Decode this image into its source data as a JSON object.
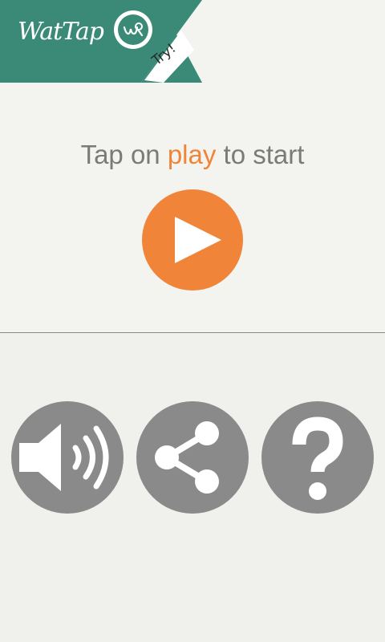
{
  "header": {
    "logo_text": "WatTap",
    "try_label": "Try!",
    "badge_icon": "wr-logo-icon",
    "brand_color": "#3a8a78"
  },
  "main": {
    "instruction_prefix": "Tap on ",
    "instruction_accent": "play",
    "instruction_suffix": " to start",
    "accent_color": "#f0853a",
    "play_icon": "play-icon"
  },
  "controls": {
    "sound_icon": "speaker-icon",
    "share_icon": "share-icon",
    "help_icon": "question-mark-icon",
    "button_color": "#8a8a8a"
  }
}
